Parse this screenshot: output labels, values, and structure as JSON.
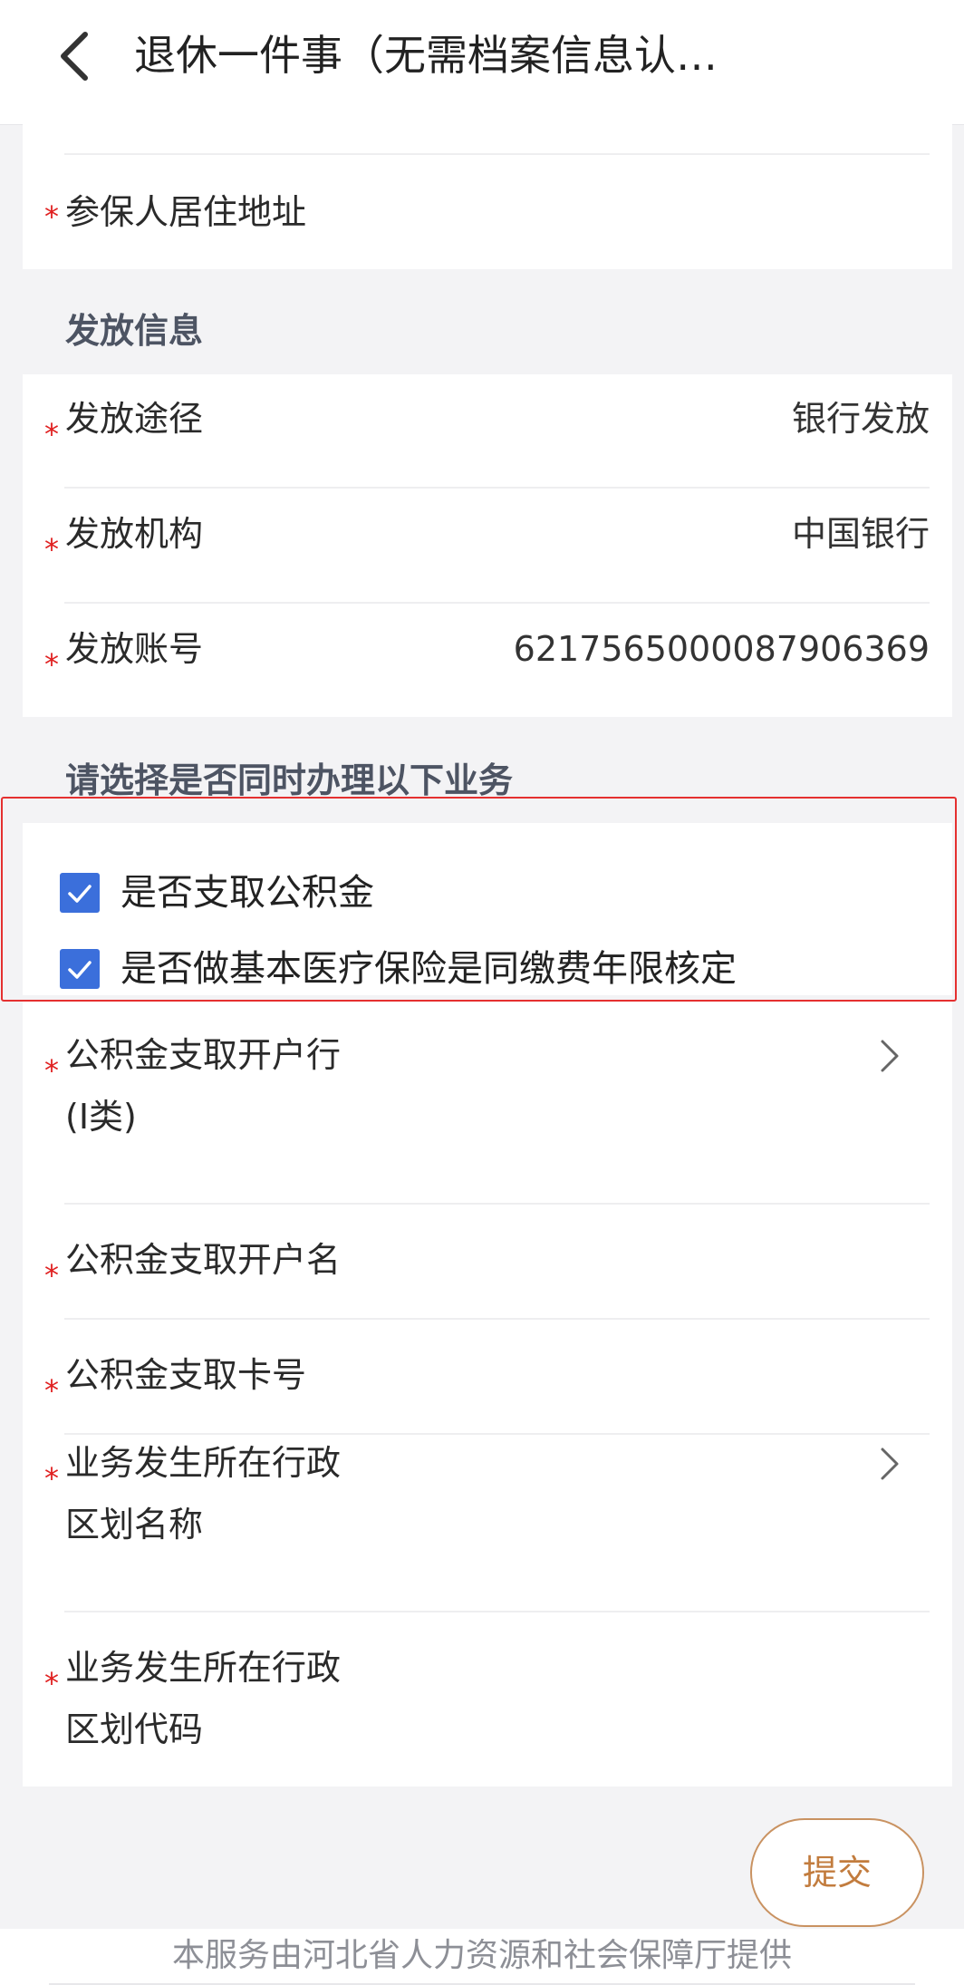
{
  "header": {
    "title": "退休一件事（无需档案信息认…",
    "back_icon": "chevron-left-icon"
  },
  "residence_card": {
    "required_mark": "*",
    "address_label": "参保人居住地址"
  },
  "payment_section": {
    "title": "发放信息",
    "rows": [
      {
        "label": "发放途径",
        "value": "银行发放"
      },
      {
        "label": "发放机构",
        "value": "中国银行"
      },
      {
        "label": "发放账号",
        "value": "6217565000087906369"
      }
    ]
  },
  "extra_section": {
    "title": "请选择是否同时办理以下业务",
    "options": [
      {
        "label": "是否支取公积金",
        "checked": true
      },
      {
        "label": "是否做基本医疗保险是同缴费年限核定",
        "checked": true
      }
    ]
  },
  "fund_card": {
    "rows": [
      {
        "label_line1": "公积金支取开户行",
        "label_line2": "(I类)",
        "has_chevron": true
      },
      {
        "label_line1": "公积金支取开户名",
        "label_line2": "",
        "has_chevron": false
      },
      {
        "label_line1": "公积金支取卡号",
        "label_line2": "",
        "has_chevron": false
      },
      {
        "label_line1": "业务发生所在行政",
        "label_line2": "区划名称",
        "has_chevron": true
      },
      {
        "label_line1": "业务发生所在行政",
        "label_line2": "区划代码",
        "has_chevron": false
      }
    ]
  },
  "submit": {
    "label": "提交"
  },
  "footer": {
    "text": "本服务由河北省人力资源和社会保障厅提供"
  },
  "colors": {
    "checkbox": "#3b6fdb",
    "required": "#e02020",
    "submit": "#c27c3e",
    "highlight": "#e53030"
  }
}
